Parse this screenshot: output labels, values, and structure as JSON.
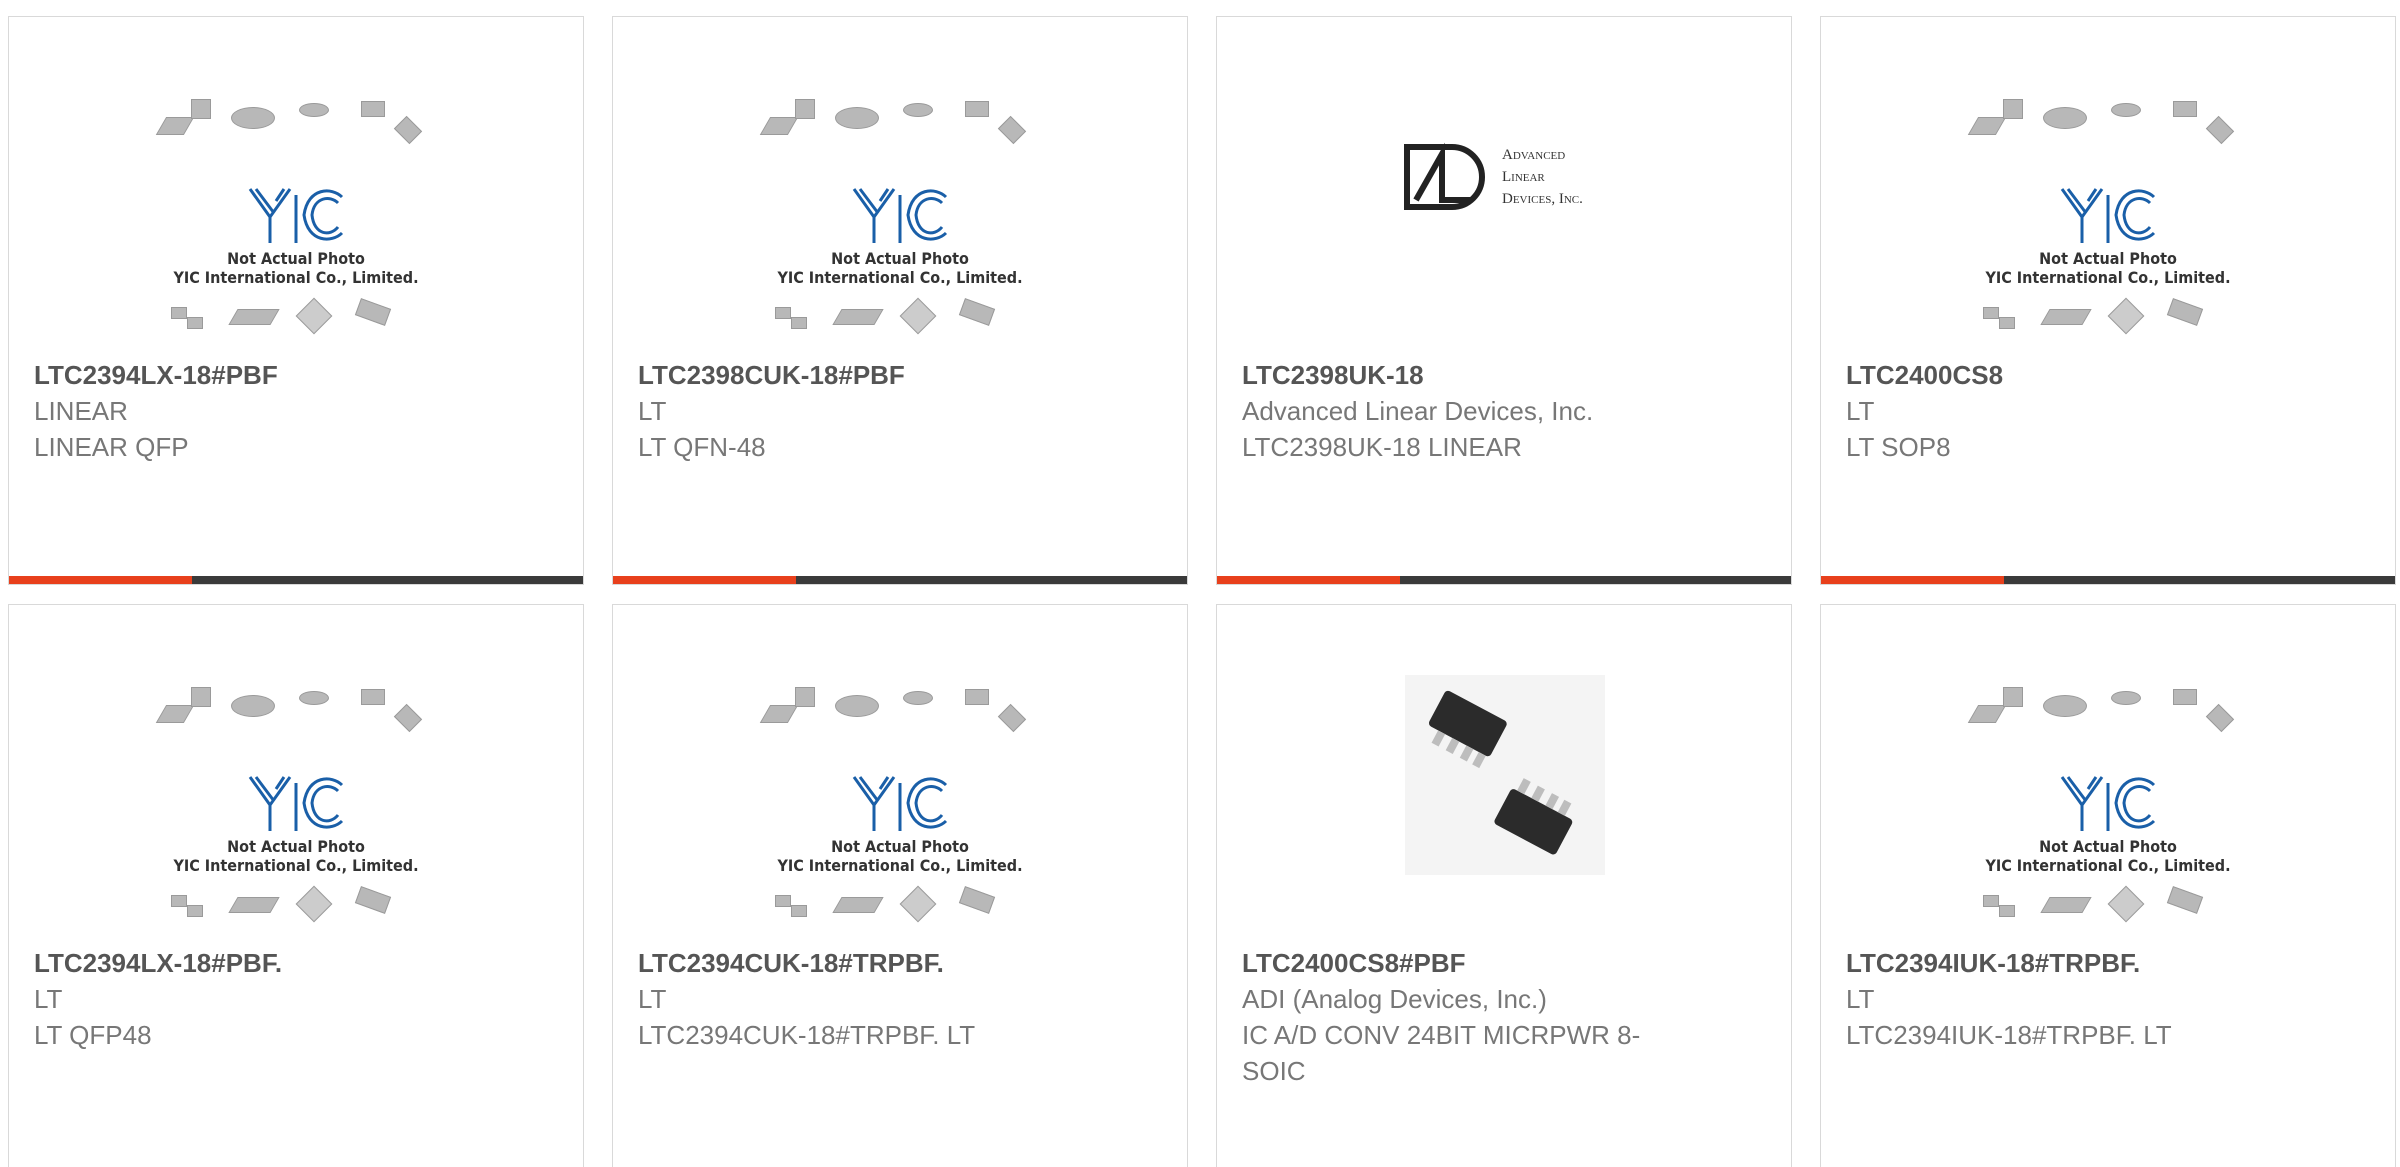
{
  "colors": {
    "accent": "#e8401c",
    "bar": "#3a3a3a",
    "logo_blue": "#1a5fa8"
  },
  "placeholder": {
    "logo_text": "YIC",
    "line1": "Not Actual Photo",
    "line2": "YIC International Co., Limited."
  },
  "ald_logo": {
    "line1": "Advanced",
    "line2": "Linear",
    "line3": "Devices, Inc."
  },
  "products": [
    {
      "part": "LTC2394LX-18#PBF",
      "manufacturer": "LINEAR",
      "description": "LINEAR QFP",
      "image": "placeholder"
    },
    {
      "part": "LTC2398CUK-18#PBF",
      "manufacturer": "LT",
      "description": "LT QFN-48",
      "image": "placeholder"
    },
    {
      "part": "LTC2398UK-18",
      "manufacturer": "Advanced Linear Devices, Inc.",
      "description": "LTC2398UK-18 LINEAR",
      "image": "ald-logo"
    },
    {
      "part": "LTC2400CS8",
      "manufacturer": "LT",
      "description": "LT SOP8",
      "image": "placeholder"
    },
    {
      "part": "LTC2394LX-18#PBF.",
      "manufacturer": "LT",
      "description": "LT QFP48",
      "image": "placeholder"
    },
    {
      "part": "LTC2394CUK-18#TRPBF.",
      "manufacturer": "LT",
      "description": "LTC2394CUK-18#TRPBF. LT",
      "image": "placeholder"
    },
    {
      "part": "LTC2400CS8#PBF",
      "manufacturer": "ADI (Analog Devices, Inc.)",
      "description": "IC A/D CONV 24BIT MICRPWR 8-SOIC",
      "image": "soic-photo"
    },
    {
      "part": "LTC2394IUK-18#TRPBF.",
      "manufacturer": "LT",
      "description": "LTC2394IUK-18#TRPBF. LT",
      "image": "placeholder"
    }
  ]
}
